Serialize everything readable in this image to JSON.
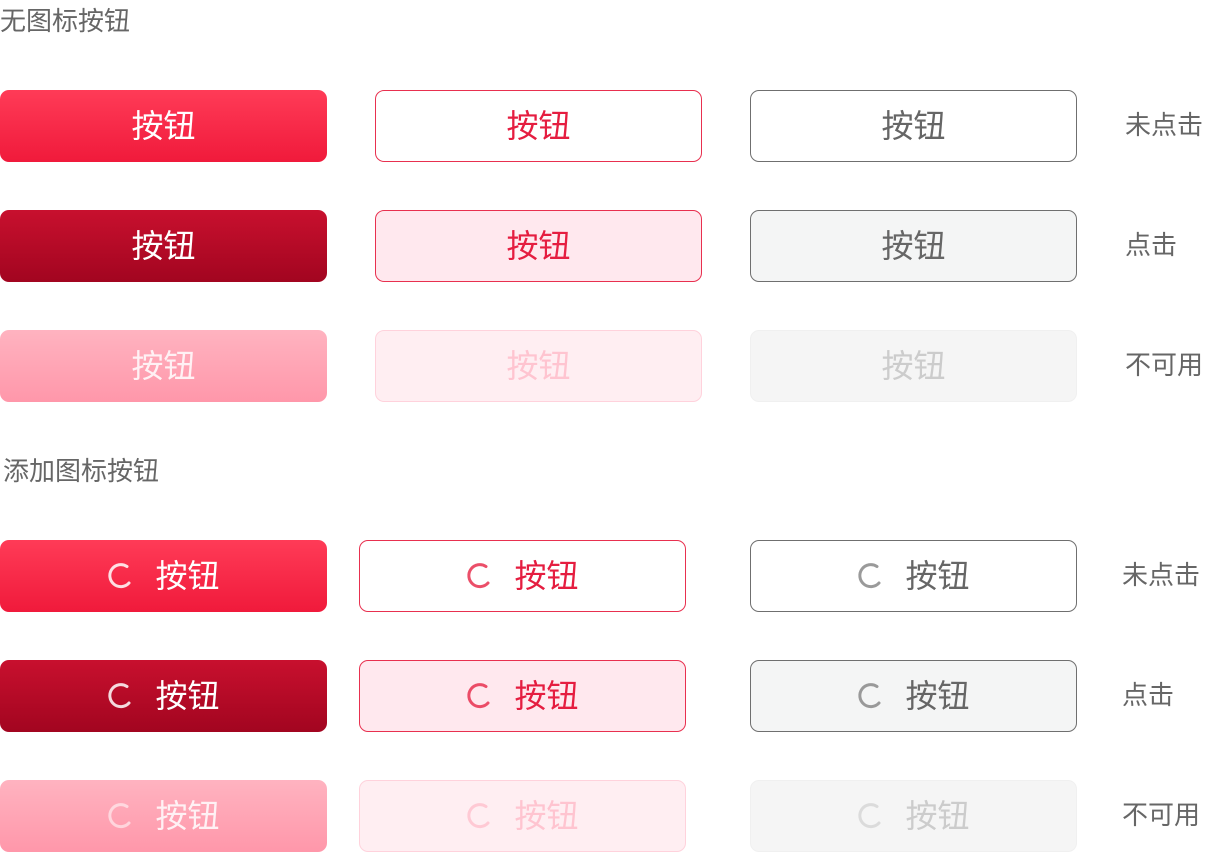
{
  "sections": [
    {
      "title": "无图标按钮",
      "with_icon": false,
      "rows": [
        {
          "state_label": "未点击",
          "buttons": [
            "按钮",
            "按钮",
            "按钮"
          ]
        },
        {
          "state_label": "点击",
          "buttons": [
            "按钮",
            "按钮",
            "按钮"
          ]
        },
        {
          "state_label": "不可用",
          "buttons": [
            "按钮",
            "按钮",
            "按钮"
          ]
        }
      ]
    },
    {
      "title": "添加图标按钮",
      "with_icon": true,
      "icon": "loading-spinner-icon",
      "rows": [
        {
          "state_label": "未点击",
          "buttons": [
            "按钮",
            "按钮",
            "按钮"
          ]
        },
        {
          "state_label": "点击",
          "buttons": [
            "按钮",
            "按钮",
            "按钮"
          ]
        },
        {
          "state_label": "不可用",
          "buttons": [
            "按钮",
            "按钮",
            "按钮"
          ]
        }
      ]
    }
  ],
  "colors": {
    "primary": "#f01a3b",
    "primary_pressed": "#a20520",
    "primary_disabled": "#ff97aa",
    "outline_red": "#e8304f",
    "gray_border": "#6f6f6f",
    "text_gray": "#666666"
  }
}
